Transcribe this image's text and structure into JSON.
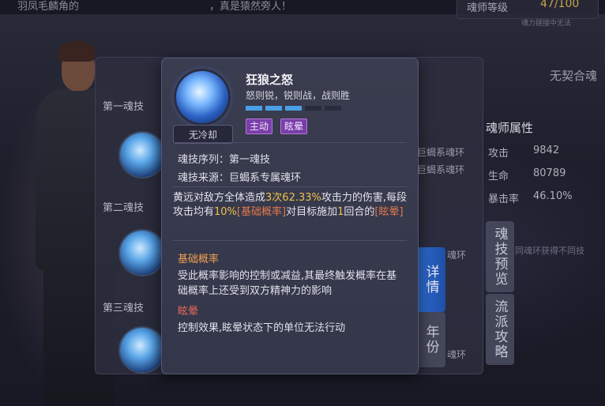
{
  "top": {
    "left_text": "羽凤毛麟角的",
    "mid_text": "，真是猿然旁人！",
    "rank_label": "魂师等级",
    "rank_value": "47/100",
    "rank_sub": "魂力链接中无法"
  },
  "slots": [
    {
      "label": "第一魂技"
    },
    {
      "label": "第二魂技"
    },
    {
      "label": "第三魂技"
    }
  ],
  "right_panel": {
    "no_contract": "无契合魂",
    "ring_tags": [
      "巨蝎系魂环",
      "巨蝎系魂环",
      "魂环",
      "魂环"
    ],
    "attr_title": "魂师属性",
    "attrs": [
      {
        "name": "攻击",
        "value": "9842"
      },
      {
        "name": "生命",
        "value": "80789"
      },
      {
        "name": "暴击率",
        "value": "46.10%"
      }
    ],
    "footer_note": "同魂环获得不同技"
  },
  "tabs": {
    "details": "详情",
    "year": "年份",
    "preview": "魂技预览",
    "strategy": "流派攻略"
  },
  "popup": {
    "skill_name": "狂狼之怒",
    "motto": "怒则锐，锐则战，战则胜",
    "cooldown": "无冷却",
    "level_pips": {
      "filled": 3,
      "total": 5
    },
    "tags": [
      "主动",
      "眩晕"
    ],
    "sequence_label": "魂技序列：",
    "sequence_value": "第一魂技",
    "source_label": "魂技来源：",
    "source_value": "巨蝎系专属魂环",
    "desc": {
      "p1": "黄远对敌方全体造成",
      "hits": "3次",
      "pct": "62.33%",
      "p2": "攻击力的伤害,每段攻击均有",
      "chance": "10%",
      "base_kw": "[基础概率]",
      "p3": "对目标施加",
      "rounds": "1",
      "p4": "回合的",
      "stun_kw": "[眩晕]"
    },
    "term1_title": "基础概率",
    "term1_body": "受此概率影响的控制或减益,其最终触发概率在基础概率上还受到双方精神力的影响",
    "term2_title": "眩晕",
    "term2_body": "控制效果,眩晕状态下的单位无法行动"
  },
  "colors": {
    "accent_blue": "#2e6fd6",
    "tag_purple": "#7a3ea8",
    "highlight_gold": "#f0c24a",
    "highlight_orange": "#e07a4a"
  }
}
